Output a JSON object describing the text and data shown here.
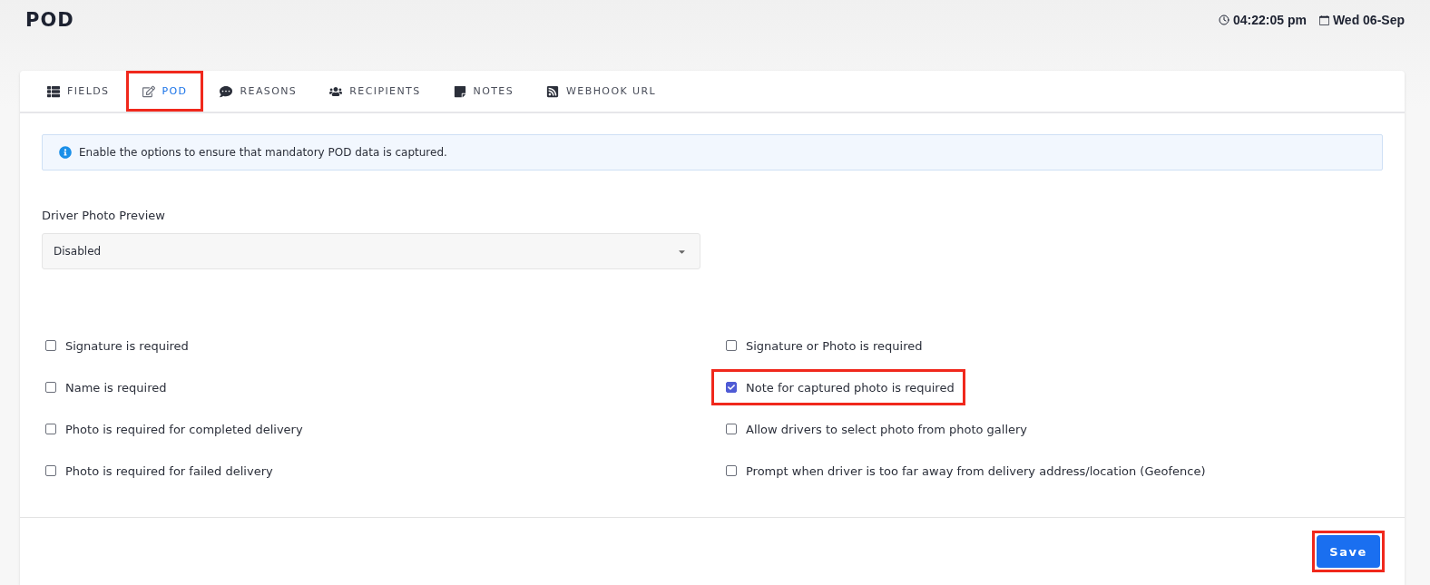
{
  "page": {
    "title": "POD",
    "time": "04:22:05 pm",
    "date": "Wed 06-Sep"
  },
  "tabs": [
    {
      "label": "FIELDS",
      "selected": false,
      "highlighted": false
    },
    {
      "label": "POD",
      "selected": true,
      "highlighted": true
    },
    {
      "label": "REASONS",
      "selected": false,
      "highlighted": false
    },
    {
      "label": "RECIPIENTS",
      "selected": false,
      "highlighted": false
    },
    {
      "label": "NOTES",
      "selected": false,
      "highlighted": false
    },
    {
      "label": "WEBHOOK URL",
      "selected": false,
      "highlighted": false
    }
  ],
  "info": "Enable the options to ensure that mandatory POD data is captured.",
  "driver_photo_preview": {
    "label": "Driver Photo Preview",
    "value": "Disabled"
  },
  "options": [
    {
      "label": "Signature is required",
      "checked": false,
      "highlighted": false
    },
    {
      "label": "Signature or Photo is required",
      "checked": false,
      "highlighted": false
    },
    {
      "label": "Name is required",
      "checked": false,
      "highlighted": false
    },
    {
      "label": "Note for captured photo is required",
      "checked": true,
      "highlighted": true
    },
    {
      "label": "Photo is required for completed delivery",
      "checked": false,
      "highlighted": false
    },
    {
      "label": "Allow drivers to select photo from photo gallery",
      "checked": false,
      "highlighted": false
    },
    {
      "label": "Photo is required for failed delivery",
      "checked": false,
      "highlighted": false
    },
    {
      "label": "Prompt when driver is too far away from delivery address/location (Geofence)",
      "checked": false,
      "highlighted": false
    }
  ],
  "save_button": {
    "label": "Save",
    "highlighted": true
  }
}
